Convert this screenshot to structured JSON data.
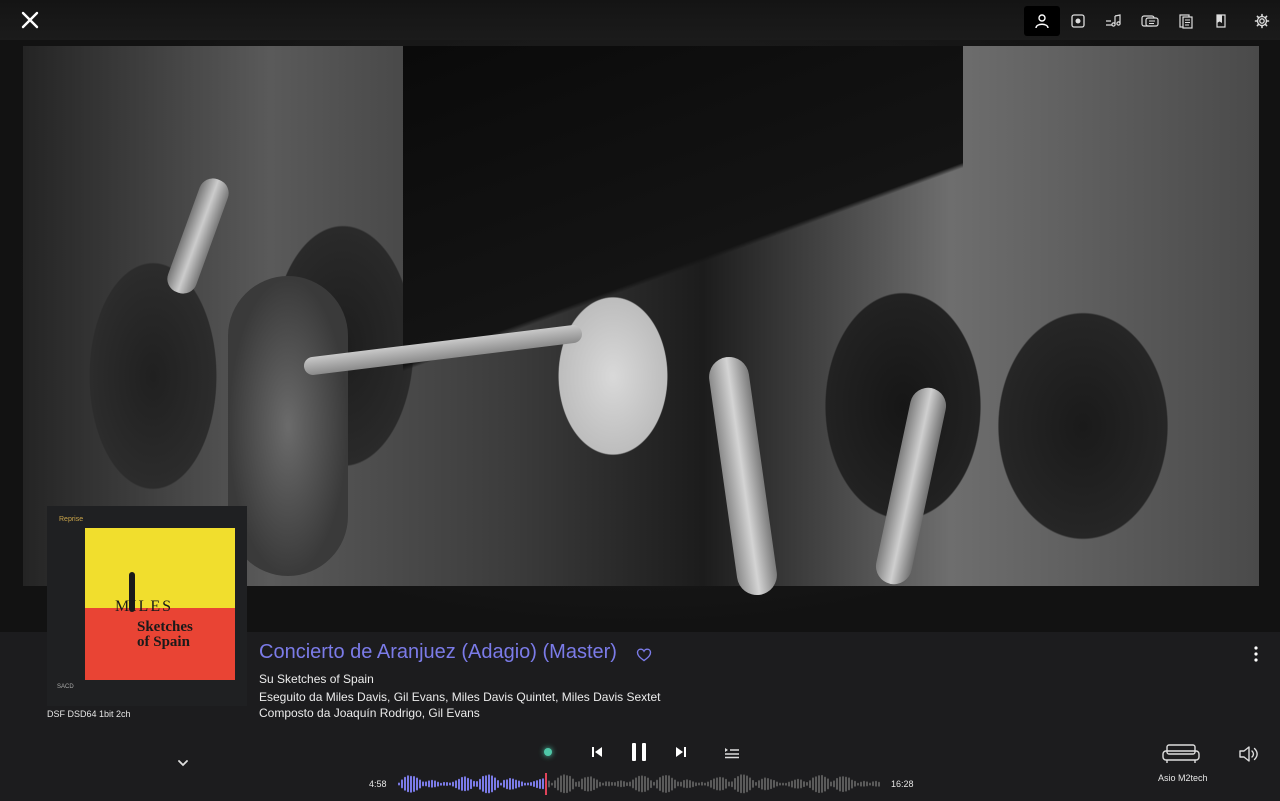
{
  "toolbar": {
    "close_icon": "close-icon",
    "icons": [
      "artist-icon",
      "album-icon",
      "lyrics-icon",
      "credits-icon",
      "booklet-icon",
      "info-icon",
      "settings-icon"
    ],
    "active_index": 0
  },
  "album_art": {
    "label": "Reprise",
    "title_line1": "MILES",
    "title_line2": "Sketches",
    "title_line3": "of Spain",
    "disc_logo": "SACD"
  },
  "format": "DSF DSD64 1bit 2ch",
  "track": {
    "title": "Concierto de Aranjuez (Adagio) (Master)",
    "album_line": "Su Sketches of Spain",
    "performer_line": "Eseguito da Miles Davis, Gil Evans, Miles Davis Quintet, Miles Davis Sextet",
    "composer_line": "Composto da Joaquín Rodrigo, Gil Evans"
  },
  "playback": {
    "elapsed": "4:58",
    "total": "16:28",
    "progress": 0.302,
    "state": "playing"
  },
  "device": {
    "label": "Asio M2tech"
  },
  "colors": {
    "accent": "#7b7be8",
    "played_wave": "#7b7be8",
    "unplayed_wave": "#5a5a5a",
    "playhead": "#e0435a",
    "status_dot": "#4fc7a8"
  }
}
